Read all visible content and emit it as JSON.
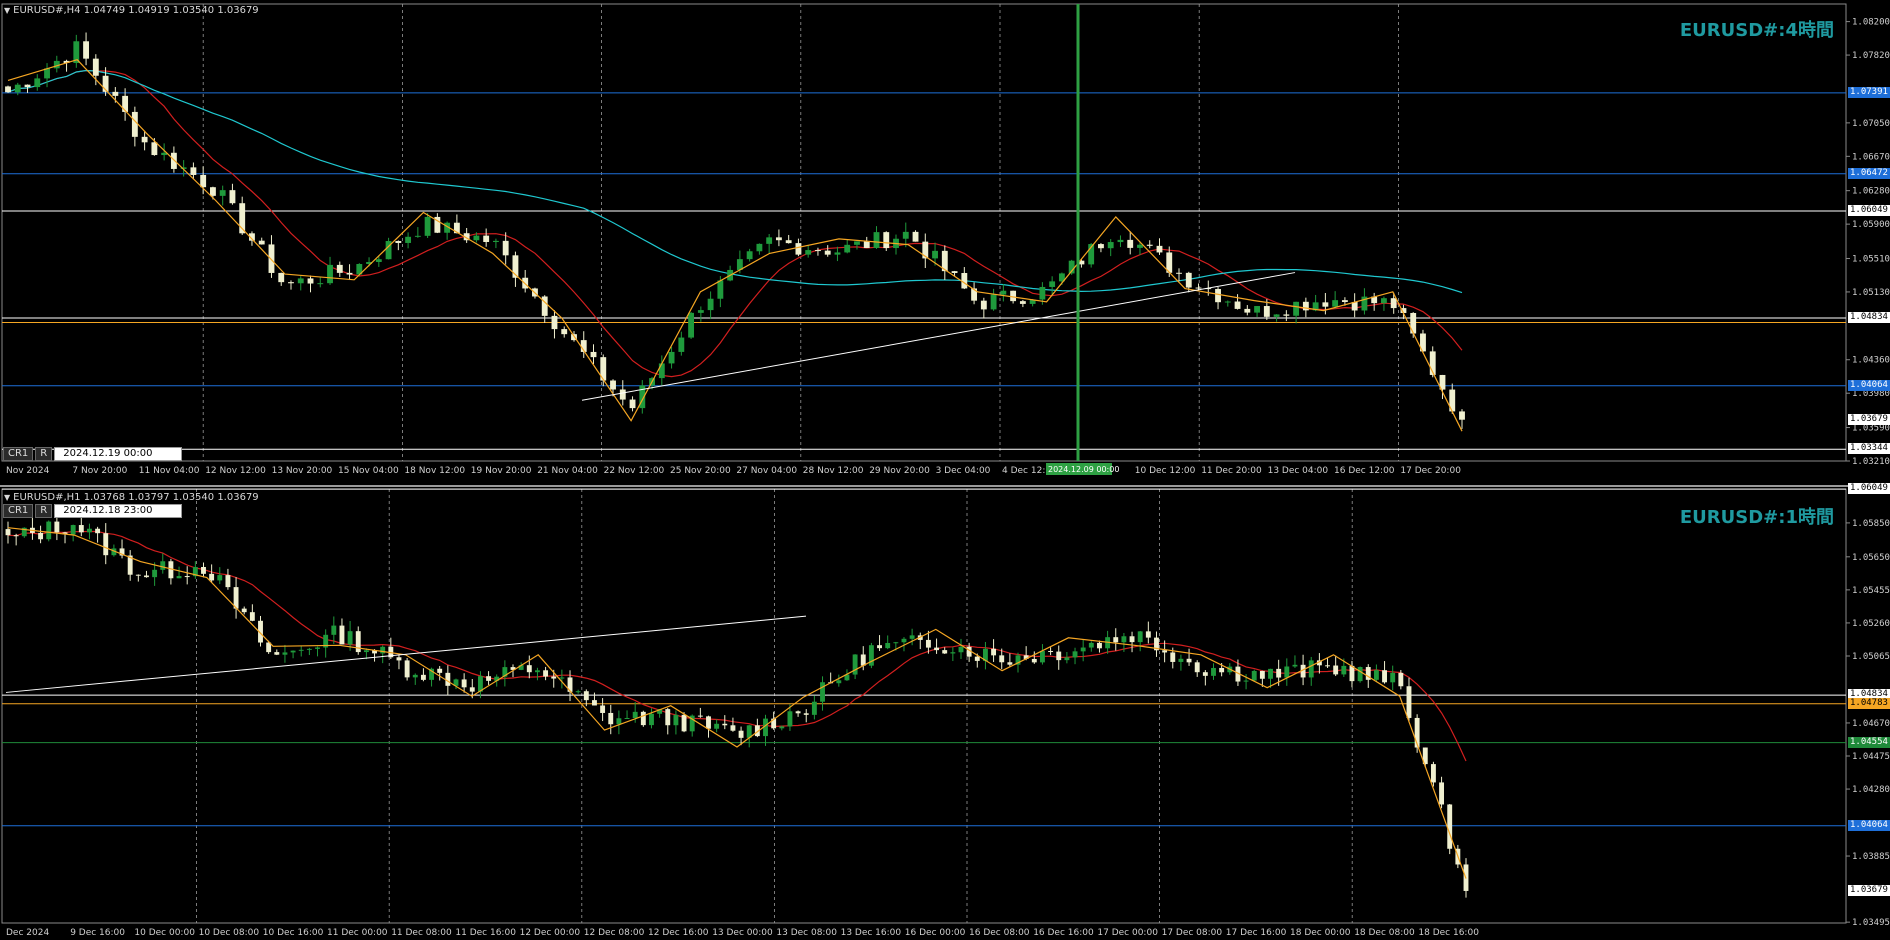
{
  "pane_h4": {
    "header": "EURUSD#,H4  1.04749 1.04919 1.03540 1.03679",
    "watermark": "EURUSD#:4時間",
    "cr_label": "CR1",
    "r_label": "R",
    "datetime": "2024.12.19 00:00",
    "crosshair_label": "2024.12.09 00:00",
    "price_ticks": [
      "1.08200",
      "1.07820",
      "1.07050",
      "1.06670",
      "1.06280",
      "1.05900",
      "1.05510",
      "1.05130",
      "1.04360",
      "1.03980",
      "1.03590",
      "1.03210"
    ],
    "time_ticks": [
      "Nov 2024",
      "7 Nov 20:00",
      "11 Nov 04:00",
      "12 Nov 12:00",
      "13 Nov 20:00",
      "15 Nov 04:00",
      "18 Nov 12:00",
      "19 Nov 20:00",
      "21 Nov 04:00",
      "22 Nov 12:00",
      "25 Nov 20:00",
      "27 Nov 04:00",
      "28 Nov 12:00",
      "29 Nov 20:00",
      "3 Dec 04:00",
      "4 Dec 12:00",
      "5 D",
      "10 Dec 12:00",
      "11 Dec 20:00",
      "13 Dec 04:00",
      "16 Dec 12:00",
      "17 Dec 20:00"
    ],
    "level_tags": [
      {
        "label": "1.07391",
        "bg": "#1e6fd9",
        "fg": "#ffffff"
      },
      {
        "label": "1.06472",
        "bg": "#1e6fd9",
        "fg": "#ffffff"
      },
      {
        "label": "1.06049",
        "bg": "#ffffff",
        "fg": "#000000"
      },
      {
        "label": "1.04834",
        "bg": "#ffffff",
        "fg": "#000000"
      },
      {
        "label": "1.04064",
        "bg": "#1e6fd9",
        "fg": "#ffffff"
      },
      {
        "label": "1.03679",
        "bg": "#ffffff",
        "fg": "#000000"
      },
      {
        "label": "1.03344",
        "bg": "#ffffff",
        "fg": "#000000"
      }
    ]
  },
  "pane_h1": {
    "header": "EURUSD#,H1  1.03768 1.03797 1.03540 1.03679",
    "watermark": "EURUSD#:1時間",
    "cr_label": "CR1",
    "r_label": "R",
    "datetime": "2024.12.18 23:00",
    "price_ticks": [
      "1.05850",
      "1.05650",
      "1.05455",
      "1.05260",
      "1.05065",
      "1.04670",
      "1.04475",
      "1.04280",
      "1.03885",
      "1.03495"
    ],
    "time_ticks": [
      "Dec 2024",
      "9 Dec 16:00",
      "10 Dec 00:00",
      "10 Dec 08:00",
      "10 Dec 16:00",
      "11 Dec 00:00",
      "11 Dec 08:00",
      "11 Dec 16:00",
      "12 Dec 00:00",
      "12 Dec 08:00",
      "12 Dec 16:00",
      "13 Dec 00:00",
      "13 Dec 08:00",
      "13 Dec 16:00",
      "16 Dec 00:00",
      "16 Dec 08:00",
      "16 Dec 16:00",
      "17 Dec 00:00",
      "17 Dec 08:00",
      "17 Dec 16:00",
      "18 Dec 00:00",
      "18 Dec 08:00",
      "18 Dec 16:00"
    ],
    "level_tags": [
      {
        "label": "1.06049",
        "bg": "#ffffff",
        "fg": "#000000"
      },
      {
        "label": "1.04834",
        "bg": "#ffffff",
        "fg": "#000000"
      },
      {
        "label": "1.04783",
        "bg": "#f5a623",
        "fg": "#000000"
      },
      {
        "label": "1.04554",
        "bg": "#1f8a3a",
        "fg": "#ffffff"
      },
      {
        "label": "1.04064",
        "bg": "#1e6fd9",
        "fg": "#ffffff"
      },
      {
        "label": "1.03679",
        "bg": "#ffffff",
        "fg": "#000000"
      }
    ]
  },
  "colors": {
    "background": "#000000",
    "bull_candle": "#1f9a3c",
    "bear_candle": "#f0f0d0",
    "ma_short": "#d21f1f",
    "ma_long": "#1fc8d0",
    "zigzag": "#f5a623",
    "trendline": "#ffffff",
    "level_blue": "#1e6fd9",
    "level_white": "#ffffff",
    "level_orange": "#f5a623",
    "level_green": "#1f8a3a",
    "crosshair": "#2ea043"
  },
  "chart_data": [
    {
      "type": "candlestick",
      "title": "EURUSD#,H4",
      "ylim": [
        1.0321,
        1.084
      ],
      "last_price": 1.03679,
      "horizontal_levels": [
        1.07391,
        1.06472,
        1.06049,
        1.04834,
        1.04783,
        1.04064,
        1.03344
      ],
      "close_path": [
        {
          "x": "Nov 2024",
          "y": 1.074
        },
        {
          "x": "7 Nov 20:00",
          "y": 1.079
        },
        {
          "x": "11 Nov 04:00",
          "y": 1.068
        },
        {
          "x": "12 Nov 12:00",
          "y": 1.063
        },
        {
          "x": "13 Nov 20:00",
          "y": 1.052
        },
        {
          "x": "15 Nov 04:00",
          "y": 1.054
        },
        {
          "x": "18 Nov 12:00",
          "y": 1.059
        },
        {
          "x": "19 Nov 20:00",
          "y": 1.057
        },
        {
          "x": "21 Nov 04:00",
          "y": 1.047
        },
        {
          "x": "22 Nov 12:00",
          "y": 1.038
        },
        {
          "x": "25 Nov 20:00",
          "y": 1.05
        },
        {
          "x": "27 Nov 04:00",
          "y": 1.057
        },
        {
          "x": "28 Nov 12:00",
          "y": 1.056
        },
        {
          "x": "29 Nov 20:00",
          "y": 1.058
        },
        {
          "x": "3 Dec 04:00",
          "y": 1.05
        },
        {
          "x": "4 Dec 12:00",
          "y": 1.0515
        },
        {
          "x": "5 D",
          "y": 1.0585
        },
        {
          "x": "10 Dec 12:00",
          "y": 1.053
        },
        {
          "x": "11 Dec 20:00",
          "y": 1.049
        },
        {
          "x": "13 Dec 04:00",
          "y": 1.0505
        },
        {
          "x": "16 Dec 12:00",
          "y": 1.05
        },
        {
          "x": "17 Dec 20:00",
          "y": 1.0368
        }
      ]
    },
    {
      "type": "candlestick",
      "title": "EURUSD#,H1",
      "ylim": [
        1.0349,
        1.0605
      ],
      "last_price": 1.03679,
      "horizontal_levels": [
        1.06049,
        1.04834,
        1.04783,
        1.04554,
        1.04064
      ],
      "close_path": [
        {
          "x": "Dec 2024",
          "y": 1.0575
        },
        {
          "x": "9 Dec 16:00",
          "y": 1.0585
        },
        {
          "x": "10 Dec 00:00",
          "y": 1.0555
        },
        {
          "x": "10 Dec 08:00",
          "y": 1.056
        },
        {
          "x": "10 Dec 16:00",
          "y": 1.0505
        },
        {
          "x": "11 Dec 00:00",
          "y": 1.052
        },
        {
          "x": "11 Dec 08:00",
          "y": 1.05
        },
        {
          "x": "11 Dec 16:00",
          "y": 1.049
        },
        {
          "x": "12 Dec 00:00",
          "y": 1.05
        },
        {
          "x": "12 Dec 08:00",
          "y": 1.047
        },
        {
          "x": "12 Dec 16:00",
          "y": 1.047
        },
        {
          "x": "13 Dec 00:00",
          "y": 1.046
        },
        {
          "x": "13 Dec 08:00",
          "y": 1.0475
        },
        {
          "x": "13 Dec 16:00",
          "y": 1.051
        },
        {
          "x": "16 Dec 00:00",
          "y": 1.0515
        },
        {
          "x": "16 Dec 08:00",
          "y": 1.0505
        },
        {
          "x": "16 Dec 16:00",
          "y": 1.051
        },
        {
          "x": "17 Dec 00:00",
          "y": 1.052
        },
        {
          "x": "17 Dec 08:00",
          "y": 1.05
        },
        {
          "x": "17 Dec 16:00",
          "y": 1.0495
        },
        {
          "x": "18 Dec 00:00",
          "y": 1.05
        },
        {
          "x": "18 Dec 08:00",
          "y": 1.049
        },
        {
          "x": "18 Dec 16:00",
          "y": 1.0368
        }
      ]
    }
  ]
}
